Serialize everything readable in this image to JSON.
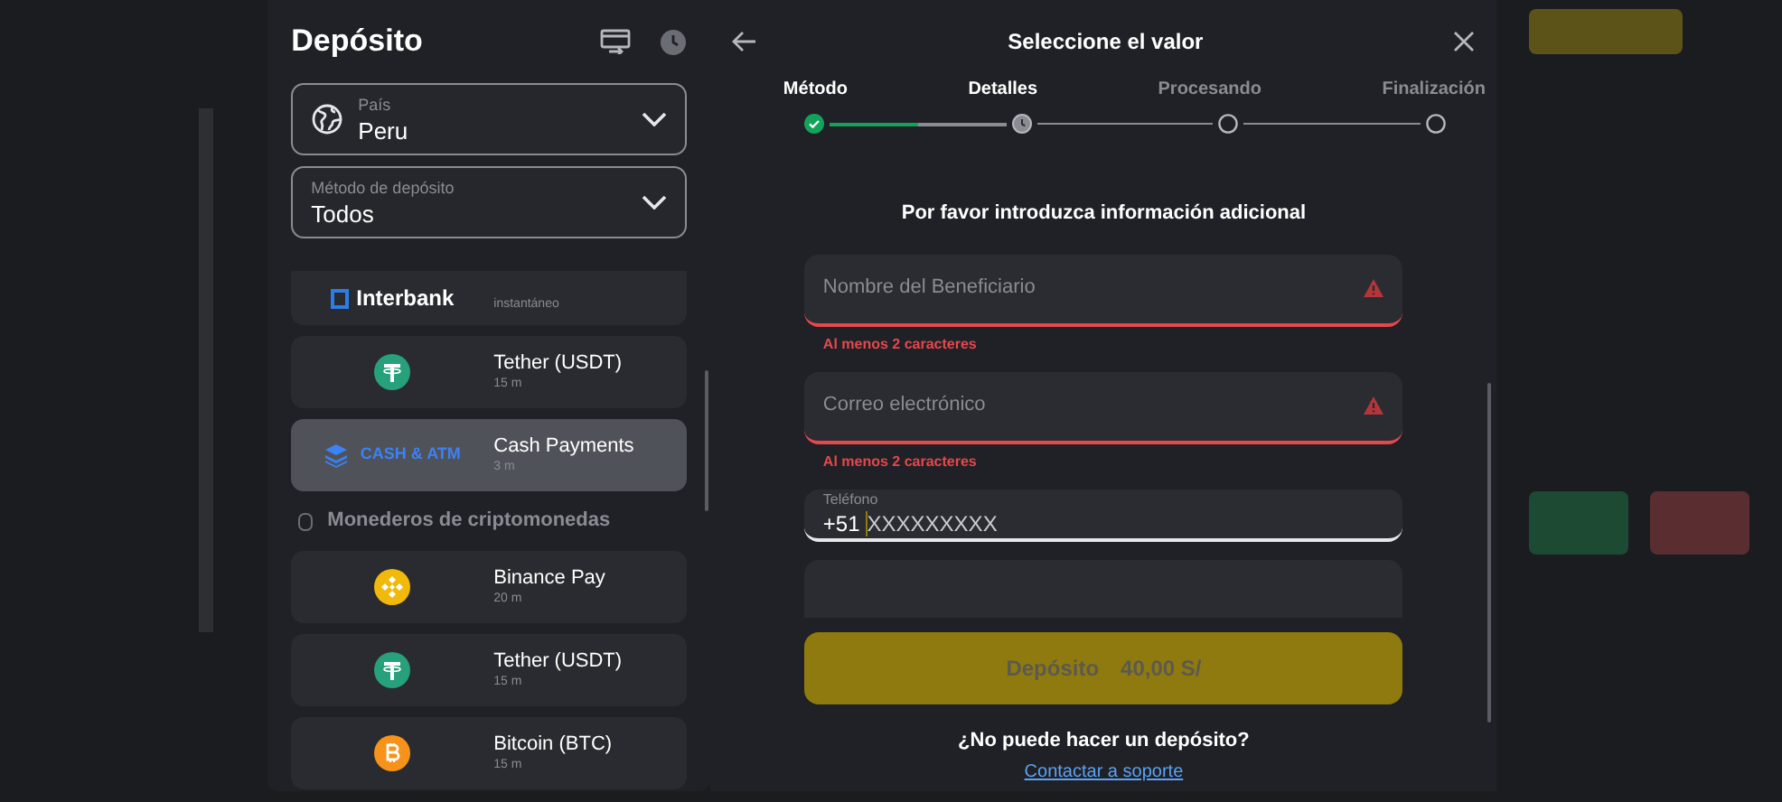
{
  "deposit_panel": {
    "title": "Depósito",
    "country": {
      "label": "País",
      "value": "Peru"
    },
    "method": {
      "label": "Método de depósito",
      "value": "Todos"
    },
    "methods": [
      {
        "kind": "bank",
        "logo": "Interbank",
        "sub": "instantáneo",
        "selected": false
      },
      {
        "kind": "tether",
        "name": "Tether (USDT)",
        "sub": "15 m",
        "selected": false
      },
      {
        "kind": "cash",
        "logo": "CASH & ATM",
        "name": "Cash Payments",
        "sub": "3 m",
        "selected": true
      },
      {
        "kind": "section",
        "name": "Monederos de criptomonedas"
      },
      {
        "kind": "binance",
        "name": "Binance Pay",
        "sub": "20 m",
        "selected": false
      },
      {
        "kind": "tether",
        "name": "Tether (USDT)",
        "sub": "15 m",
        "selected": false
      },
      {
        "kind": "bitcoin",
        "name": "Bitcoin (BTC)",
        "sub": "15 m",
        "selected": false
      }
    ]
  },
  "details_panel": {
    "title": "Seleccione el valor",
    "steps": [
      {
        "label": "Método",
        "kind": "done"
      },
      {
        "label": "Detalles",
        "kind": "current"
      },
      {
        "label": "Procesando",
        "kind": "pending"
      },
      {
        "label": "Finalización",
        "kind": "pending"
      }
    ],
    "progress": {
      "level": 0.5
    },
    "heading": "Por favor introduzca información adicional",
    "fields": [
      {
        "kind": "text",
        "placeholder": "Nombre del Beneficiario",
        "invalid": true,
        "error": "Al menos 2 caracteres"
      },
      {
        "kind": "text",
        "placeholder": "Correo electrónico",
        "invalid": true,
        "error": "Al menos 2 caracteres"
      },
      {
        "kind": "phone",
        "label": "Teléfono",
        "prefix": "+51",
        "placeholder": "XXXXXXXXX",
        "focused": true
      },
      {
        "kind": "empty"
      }
    ],
    "submit": {
      "label": "Depósito",
      "amount": "40,00 S/",
      "disabled": true
    },
    "help": {
      "question": "¿No puede hacer un depósito?",
      "link": "Contactar a soporte"
    }
  }
}
